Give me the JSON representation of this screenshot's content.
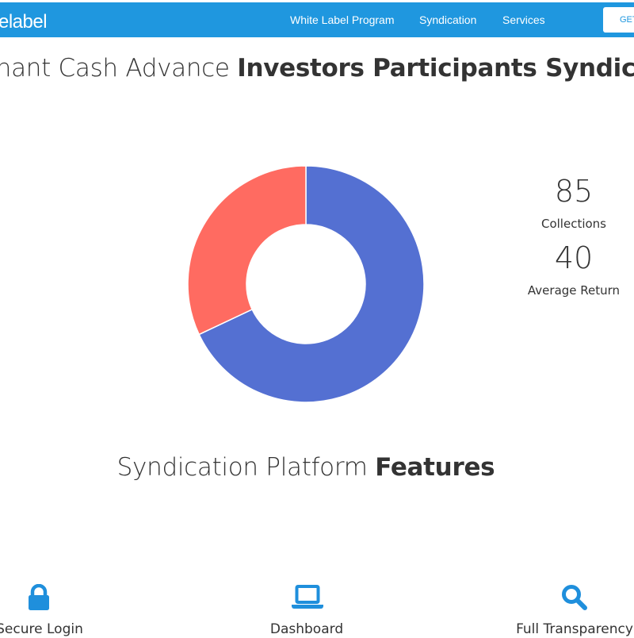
{
  "navbar": {
    "brand": "elabel",
    "links": [
      "White Label Program",
      "Syndication",
      "Services"
    ],
    "cta_label": "GET"
  },
  "headline": {
    "regular": "chant Cash Advance ",
    "bold": "Investors Participants Syndicat"
  },
  "stats": [
    {
      "value": "85",
      "label": "Collections"
    },
    {
      "value": "40",
      "label": "Average Return"
    }
  ],
  "chart_data": {
    "type": "pie",
    "categories": [
      "Collections",
      "Average Return"
    ],
    "values": [
      85,
      40
    ],
    "colors": [
      "#5470d2",
      "#ff6b61"
    ]
  },
  "features": {
    "title_regular": "Syndication Platform ",
    "title_bold": "Features",
    "items": [
      {
        "label": "Secure Login",
        "icon": "lock-icon"
      },
      {
        "label": "Dashboard",
        "icon": "laptop-icon"
      },
      {
        "label": "Full Transparency",
        "icon": "search-icon"
      }
    ]
  },
  "colors": {
    "nav_bg": "#1f97df",
    "icon_blue": "#1f8fdc",
    "text": "#333333"
  }
}
